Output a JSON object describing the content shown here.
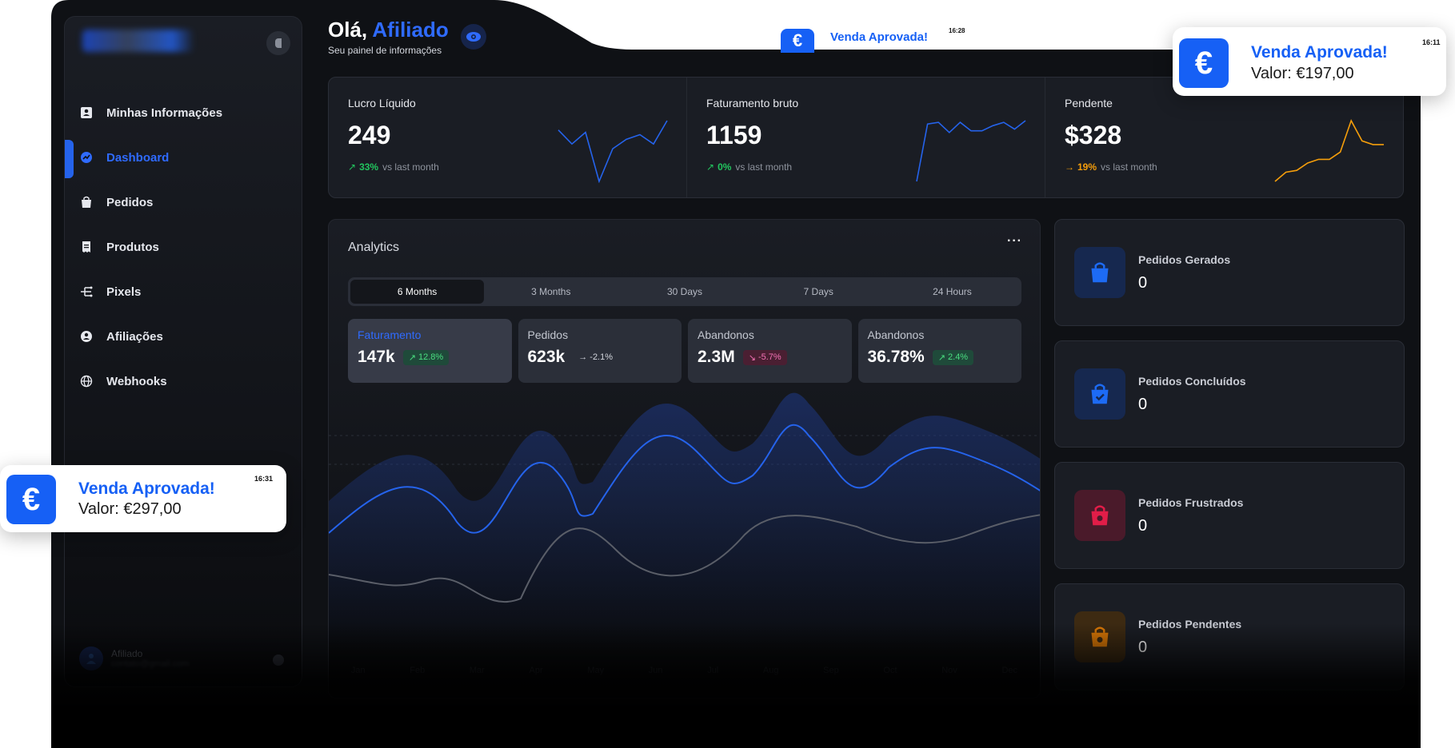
{
  "header": {
    "greeting": "Olá,",
    "name": "Afiliado",
    "subtitle": "Seu painel de informações"
  },
  "sidebar": {
    "items": [
      {
        "label": "Minhas Informações",
        "icon": "user-card-icon"
      },
      {
        "label": "Dashboard",
        "icon": "dashboard-icon"
      },
      {
        "label": "Pedidos",
        "icon": "bag-icon"
      },
      {
        "label": "Produtos",
        "icon": "receipt-icon"
      },
      {
        "label": "Pixels",
        "icon": "share-icon"
      },
      {
        "label": "Afiliações",
        "icon": "user-circle-icon"
      },
      {
        "label": "Webhooks",
        "icon": "globe-icon"
      }
    ],
    "user": {
      "name": "Afiliado",
      "email": "contato@gmail.com"
    }
  },
  "stats": [
    {
      "label": "Lucro Líquido",
      "value": "249",
      "pct": "33%",
      "suffix": "vs last month",
      "trend_color": "#22c55e",
      "spark_color": "#2563eb",
      "spark": [
        52,
        40,
        50,
        8,
        36,
        44,
        48,
        40,
        60
      ]
    },
    {
      "label": "Faturamento bruto",
      "value": "1159",
      "pct": "0%",
      "suffix": "vs last month",
      "trend_color": "#22c55e",
      "spark_color": "#2563eb",
      "spark": [
        2,
        70,
        72,
        60,
        72,
        62,
        62,
        68,
        72,
        64,
        74
      ]
    },
    {
      "label": "Pendente",
      "value": "$328",
      "pct": "19%",
      "suffix": "vs last month",
      "trend_color": "#f59e0b",
      "spark_color": "#f59e0b",
      "spark": [
        2,
        12,
        14,
        22,
        26,
        26,
        34,
        68,
        46,
        42,
        42
      ]
    }
  ],
  "analytics": {
    "title": "Analytics",
    "more": "···",
    "tabs": [
      "6 Months",
      "3 Months",
      "30 Days",
      "7 Days",
      "24 Hours"
    ],
    "active_tab": 0,
    "metrics": [
      {
        "label": "Faturamento",
        "value": "147k",
        "change": "12.8%",
        "dir": "up"
      },
      {
        "label": "Pedidos",
        "value": "623k",
        "change": "-2.1%",
        "dir": "flat"
      },
      {
        "label": "Abandonos",
        "value": "2.3M",
        "change": "-5.7%",
        "dir": "down"
      },
      {
        "label": "Abandonos",
        "value": "36.78%",
        "change": "2.4%",
        "dir": "up"
      }
    ],
    "x_labels": [
      "Jan",
      "Feb",
      "Mar",
      "Apr",
      "May",
      "Jun",
      "Jul",
      "Aug",
      "Sep",
      "Oct",
      "Nov",
      "Dec"
    ]
  },
  "orders": [
    {
      "label": "Pedidos Gerados",
      "value": "0",
      "color": "#1d6bf5",
      "bg": "#16284f"
    },
    {
      "label": "Pedidos Concluídos",
      "value": "0",
      "color": "#1d6bf5",
      "bg": "#16284f"
    },
    {
      "label": "Pedidos Frustrados",
      "value": "0",
      "color": "#e11d48",
      "bg": "#4a1a2a"
    },
    {
      "label": "Pedidos Pendentes",
      "value": "0",
      "color": "#d97706",
      "bg": "#3d2a12"
    }
  ],
  "toasts": [
    {
      "title": "Venda Aprovada!",
      "value": "Valor: €197,00",
      "time": "16:11",
      "icon": "€"
    },
    {
      "title": "Venda Aprovada!",
      "value": "Valor: €297,00",
      "time": "16:31",
      "icon": "€"
    },
    {
      "title": "Venda Aprovada!",
      "time": "16:28",
      "icon": "€"
    }
  ]
}
